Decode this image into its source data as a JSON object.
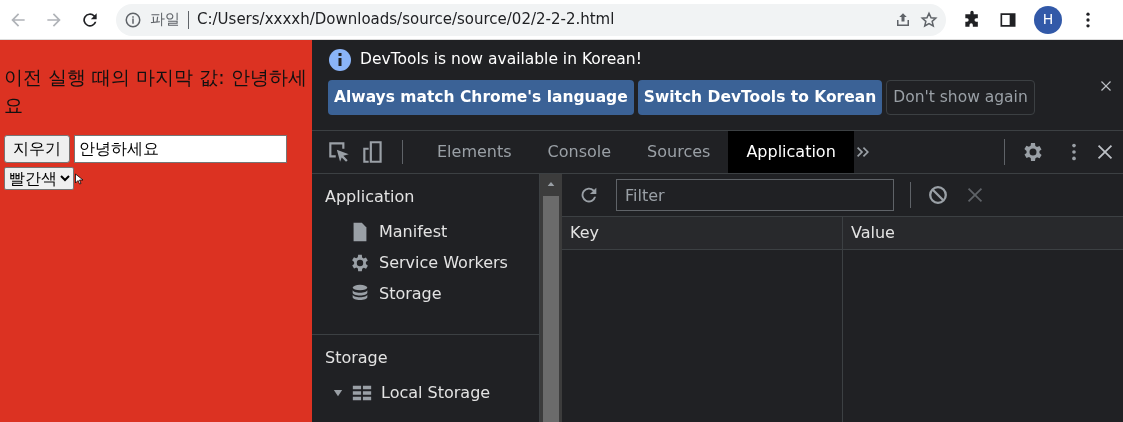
{
  "browser": {
    "scheme_label": "파일",
    "url": "C:/Users/xxxxh/Downloads/source/source/02/2-2-2.html",
    "profile_initial": "H"
  },
  "page": {
    "message": "이전 실행 때의 마지막 값: 안녕하세요",
    "clear_button": "지우기",
    "input_value": "안녕하세요",
    "select_value": "빨간색"
  },
  "devtools": {
    "infobar": {
      "message": "DevTools is now available in Korean!",
      "buttons": [
        {
          "label": "Always match Chrome's language",
          "kind": "primary"
        },
        {
          "label": "Switch DevTools to Korean",
          "kind": "primary"
        },
        {
          "label": "Don't show again",
          "kind": "secondary"
        }
      ]
    },
    "tabs": [
      {
        "label": "Elements",
        "selected": false
      },
      {
        "label": "Console",
        "selected": false
      },
      {
        "label": "Sources",
        "selected": false
      },
      {
        "label": "Application",
        "selected": true
      }
    ],
    "sidebar": [
      {
        "title": "Application",
        "items": [
          {
            "label": "Manifest",
            "kind": "file"
          },
          {
            "label": "Service Workers",
            "kind": "gear"
          },
          {
            "label": "Storage",
            "kind": "database"
          }
        ]
      },
      {
        "title": "Storage",
        "items": [
          {
            "label": "Local Storage",
            "kind": "grid",
            "expanded": true
          }
        ]
      }
    ],
    "filter": {
      "placeholder": "Filter"
    },
    "columns": [
      "Key",
      "Value"
    ]
  }
}
